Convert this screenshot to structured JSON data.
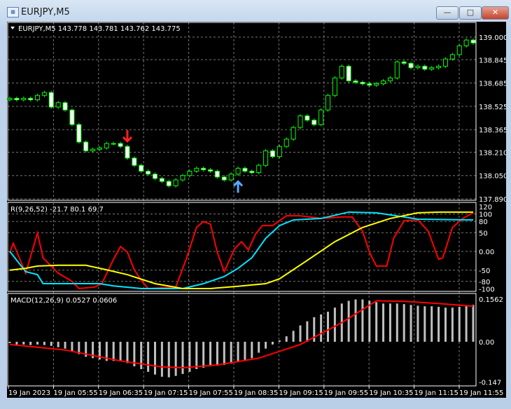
{
  "window": {
    "title": "EURJPY,M5",
    "buttons": {
      "minimize": "—",
      "maximize": "□",
      "close": "✕"
    }
  },
  "main_pane": {
    "header": "EURJPY,M5  143.778 143.781 143.762 143.775",
    "price_ticks": [
      "139.000",
      "138.845",
      "138.685",
      "138.525",
      "138.365",
      "138.210",
      "138.050",
      "137.890"
    ],
    "colors": {
      "bull": "#00ff00",
      "bear": "#ffffff",
      "sell_arrow": "#ff2020",
      "buy_arrow": "#5aa9ff"
    }
  },
  "chart_data": [
    {
      "type": "candlestick",
      "title": "EURJPY,M5",
      "ylim": [
        137.89,
        139.0
      ],
      "closes": [
        138.58,
        138.57,
        138.58,
        138.57,
        138.6,
        138.62,
        138.52,
        138.55,
        138.5,
        138.4,
        138.28,
        138.22,
        138.23,
        138.24,
        138.27,
        138.27,
        138.25,
        138.17,
        138.12,
        138.08,
        138.06,
        138.03,
        138.01,
        137.98,
        138.02,
        138.05,
        138.08,
        138.1,
        138.09,
        138.08,
        138.04,
        138.02,
        138.06,
        138.1,
        138.08,
        138.07,
        138.12,
        138.22,
        138.18,
        138.25,
        138.3,
        138.38,
        138.46,
        138.43,
        138.4,
        138.5,
        138.6,
        138.72,
        138.8,
        138.7,
        138.69,
        138.68,
        138.67,
        138.68,
        138.7,
        138.72,
        138.83,
        138.82,
        138.79,
        138.8,
        138.78,
        138.79,
        138.8,
        138.85,
        138.88,
        138.94,
        138.98,
        138.96
      ],
      "signals": [
        {
          "bar": 17,
          "type": "sell"
        },
        {
          "bar": 33,
          "type": "buy"
        }
      ],
      "x_tick_labels": [
        "19 Jan 2023",
        "19 Jan 05:55",
        "19 Jan 06:35",
        "19 Jan 07:15",
        "19 Jan 07:55",
        "19 Jan 08:35",
        "19 Jan 09:15",
        "19 Jan 09:55",
        "19 Jan 10:35",
        "19 Jan 11:15",
        "19 Jan 11:55"
      ]
    },
    {
      "type": "line",
      "title": "R(9,26,52) -21.7 80.1 69.7",
      "ylim": [
        -100,
        120
      ],
      "y_tick_labels": [
        "120",
        "100",
        "80",
        "50",
        "0.00",
        "-50",
        "-80",
        "-100"
      ],
      "series": [
        {
          "color": "#ff0000",
          "points": [
            [
              0,
              -4
            ],
            [
              0.5,
              22
            ],
            [
              2.3,
              -58
            ],
            [
              4,
              49
            ],
            [
              4.8,
              -17
            ],
            [
              7,
              -58
            ],
            [
              9,
              -80
            ],
            [
              10,
              -99
            ],
            [
              12.3,
              -95
            ],
            [
              13.3,
              -86
            ],
            [
              15,
              -21
            ],
            [
              16,
              13
            ],
            [
              17,
              -2
            ],
            [
              18,
              -49
            ],
            [
              19,
              -77
            ],
            [
              20,
              -99
            ],
            [
              24,
              -95
            ],
            [
              25.5,
              -21
            ],
            [
              27,
              64
            ],
            [
              28,
              80
            ],
            [
              29,
              73
            ],
            [
              30,
              -2
            ],
            [
              31,
              -54
            ],
            [
              32.5,
              7
            ],
            [
              33.5,
              26
            ],
            [
              34.5,
              4
            ],
            [
              35.5,
              45
            ],
            [
              36.5,
              69
            ],
            [
              38,
              69
            ],
            [
              40,
              95
            ],
            [
              42,
              95
            ],
            [
              45,
              88
            ],
            [
              48,
              92
            ],
            [
              49.5,
              92
            ],
            [
              51,
              54
            ],
            [
              52,
              -2
            ],
            [
              53,
              -39
            ],
            [
              54.5,
              -39
            ],
            [
              55.5,
              35
            ],
            [
              57,
              82
            ],
            [
              59,
              84
            ],
            [
              60.5,
              54
            ],
            [
              62,
              -21
            ],
            [
              62.6,
              -17
            ],
            [
              64,
              64
            ],
            [
              65.5,
              88
            ],
            [
              67,
              103
            ]
          ]
        },
        {
          "color": "#00e5ff",
          "points": [
            [
              0,
              0
            ],
            [
              2.3,
              -54
            ],
            [
              4,
              -62
            ],
            [
              4.8,
              -86
            ],
            [
              13,
              -86
            ],
            [
              15,
              -92
            ],
            [
              19,
              -99
            ],
            [
              25,
              -99
            ],
            [
              28,
              -86
            ],
            [
              31,
              -67
            ],
            [
              33,
              -45
            ],
            [
              35,
              -17
            ],
            [
              37,
              35
            ],
            [
              39,
              69
            ],
            [
              41,
              84
            ],
            [
              45,
              88
            ],
            [
              49,
              105
            ],
            [
              53,
              103
            ],
            [
              57,
              92
            ],
            [
              59,
              86
            ],
            [
              67,
              84
            ]
          ]
        },
        {
          "color": "#ffff00",
          "points": [
            [
              0,
              -50
            ],
            [
              2.3,
              -45
            ],
            [
              4,
              -39
            ],
            [
              7,
              -37
            ],
            [
              11,
              -37
            ],
            [
              14,
              -49
            ],
            [
              17,
              -62
            ],
            [
              21,
              -86
            ],
            [
              25,
              -99
            ],
            [
              29,
              -99
            ],
            [
              33,
              -93
            ],
            [
              37,
              -86
            ],
            [
              39,
              -73
            ],
            [
              43,
              -24
            ],
            [
              47,
              26
            ],
            [
              51,
              64
            ],
            [
              55,
              88
            ],
            [
              59,
              103
            ],
            [
              62,
              105
            ],
            [
              67,
              105
            ]
          ]
        }
      ]
    },
    {
      "type": "bar+line",
      "title": "MACD(12,26,9) 0.0527 0.0606",
      "ylim": [
        -0.147,
        0.1562
      ],
      "y_tick_labels": [
        "0.1562",
        "0.00",
        "-0.147"
      ],
      "histogram": [
        -0.005,
        -0.01,
        -0.01,
        -0.012,
        -0.01,
        -0.012,
        -0.015,
        -0.02,
        -0.025,
        -0.035,
        -0.045,
        -0.055,
        -0.06,
        -0.065,
        -0.07,
        -0.07,
        -0.072,
        -0.078,
        -0.09,
        -0.1,
        -0.11,
        -0.12,
        -0.128,
        -0.13,
        -0.125,
        -0.118,
        -0.11,
        -0.1,
        -0.095,
        -0.09,
        -0.088,
        -0.085,
        -0.08,
        -0.075,
        -0.07,
        -0.06,
        -0.04,
        -0.025,
        -0.01,
        0.005,
        0.02,
        0.04,
        0.06,
        0.075,
        0.09,
        0.1,
        0.11,
        0.125,
        0.14,
        0.15,
        0.155,
        0.155,
        0.15,
        0.145,
        0.14,
        0.14,
        0.14,
        0.138,
        0.135,
        0.132,
        0.13,
        0.13,
        0.128,
        0.125,
        0.125,
        0.128,
        0.13,
        0.135
      ],
      "signal": {
        "color": "#ff0000",
        "points": [
          [
            0,
            -0.01
          ],
          [
            8,
            -0.03
          ],
          [
            16,
            -0.07
          ],
          [
            22,
            -0.092
          ],
          [
            25,
            -0.095
          ],
          [
            30,
            -0.085
          ],
          [
            36,
            -0.06
          ],
          [
            42,
            -0.01
          ],
          [
            48,
            0.07
          ],
          [
            53,
            0.15
          ],
          [
            57,
            0.148
          ],
          [
            62,
            0.14
          ],
          [
            67,
            0.13
          ]
        ]
      }
    }
  ]
}
